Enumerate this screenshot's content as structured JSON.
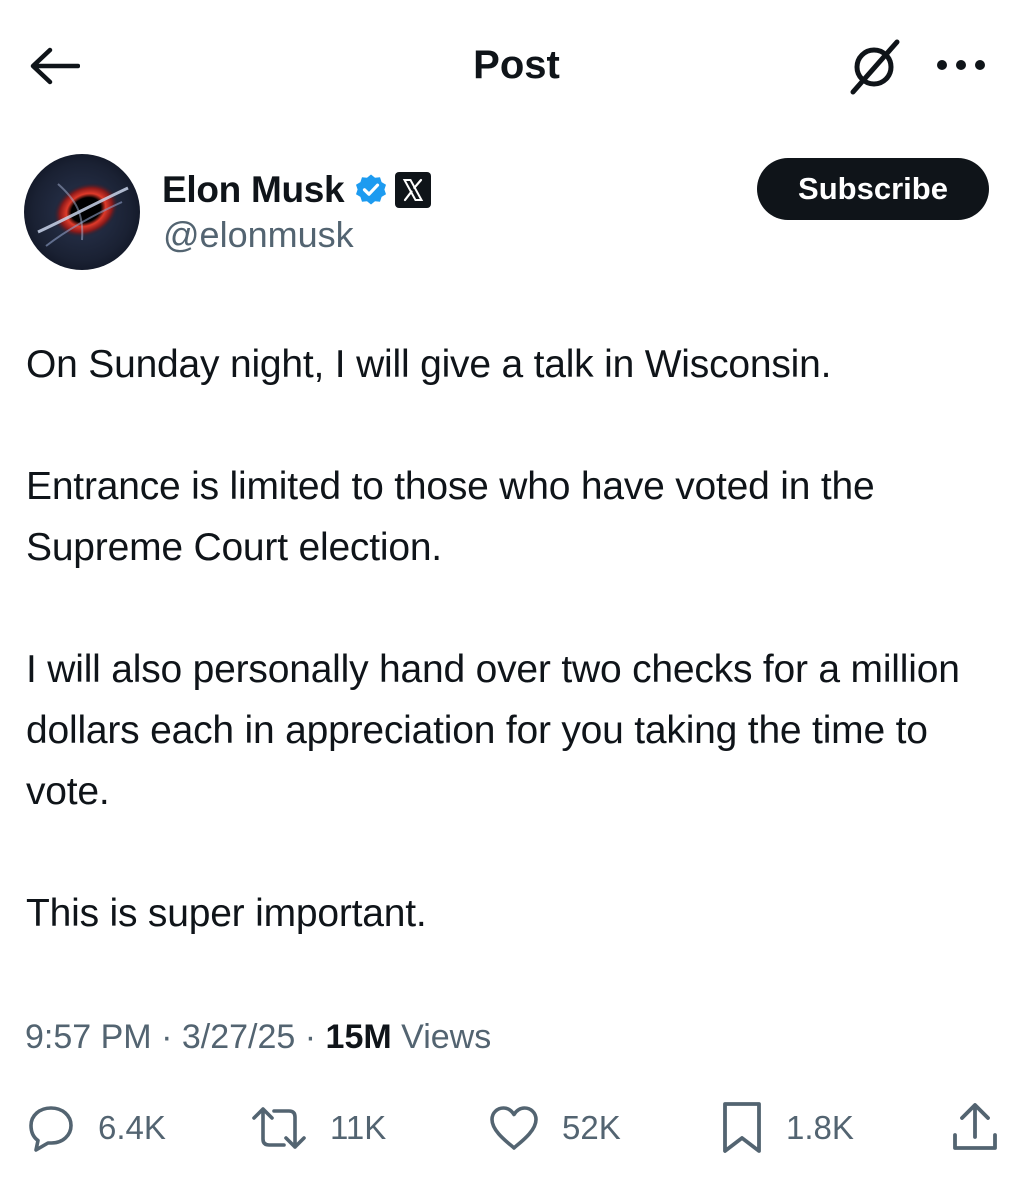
{
  "header": {
    "title": "Post",
    "back_icon": "back-arrow-icon",
    "grok_icon": "grok-icon",
    "more_icon": "more-dots-icon"
  },
  "author": {
    "display_name": "Elon Musk",
    "handle": "@elonmusk",
    "verified_icon": "verified-badge-icon",
    "affiliation_icon": "x-logo-badge-icon",
    "verified_color": "#1d9bf0"
  },
  "subscribe": {
    "label": "Subscribe"
  },
  "post": {
    "paragraphs": [
      "On Sunday night, I will give a talk in Wisconsin.",
      "Entrance is limited to those who have voted in the Supreme Court election.",
      "I will also personally hand over two checks for a million dollars each in appreciation for you taking the time to vote.",
      "This is super important."
    ]
  },
  "meta": {
    "time": "9:57 PM",
    "separator": "·",
    "date": "3/27/25",
    "views_count": "15M",
    "views_label": "Views"
  },
  "actions": {
    "replies": "6.4K",
    "reposts": "11K",
    "likes": "52K",
    "bookmarks": "1.8K"
  },
  "colors": {
    "text": "#0f1419",
    "secondary": "#536471",
    "button_bg": "#0f1419",
    "verified": "#1d9bf0"
  }
}
